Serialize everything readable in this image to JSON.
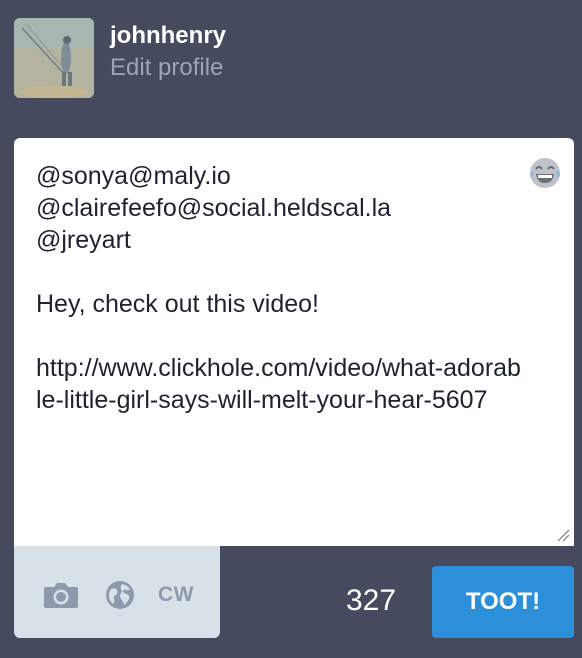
{
  "profile": {
    "username": "johnhenry",
    "edit_link": "Edit profile",
    "avatar_icon": "avatar-photo"
  },
  "compose": {
    "text": "@sonya@maly.io\n@clairefeefo@social.heldscal.la\n@jreyart\n\nHey, check out this video!\n\nhttp://www.clickhole.com/video/what-adorable-little-girl-says-will-melt-your-hear-5607",
    "emoji_icon": "laughing-emoji-icon"
  },
  "toolbar": {
    "camera_icon": "camera-icon",
    "privacy_icon": "globe-icon",
    "cw_label": "CW"
  },
  "footer": {
    "char_count": "327",
    "submit_label": "TOOT!"
  },
  "colors": {
    "background": "#454a5e",
    "accent": "#2b90d9",
    "toolbar": "#d9e1e8",
    "muted_text": "#9ba3bd"
  }
}
